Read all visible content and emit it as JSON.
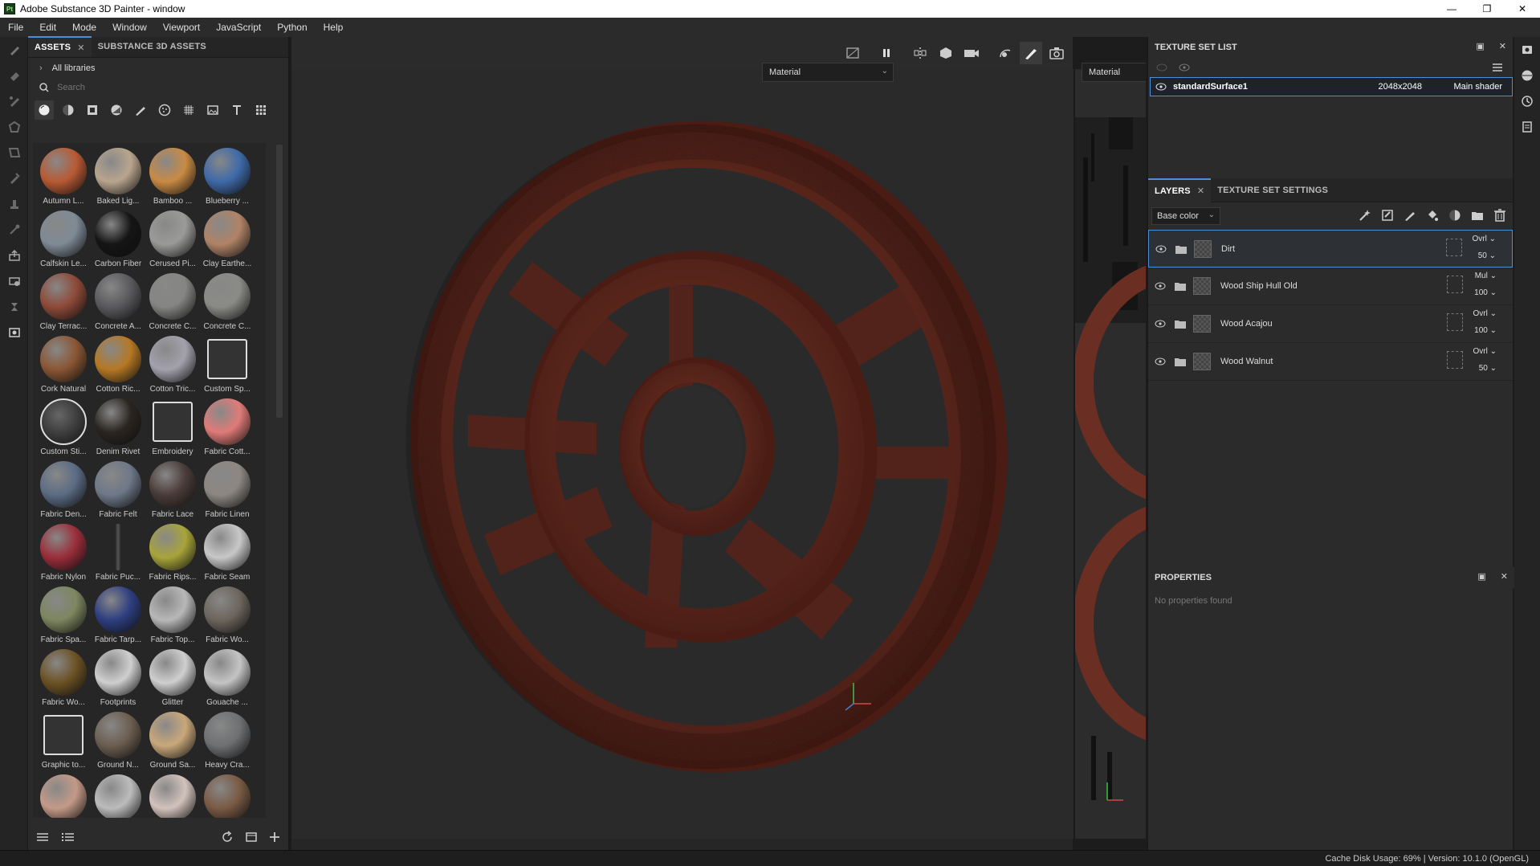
{
  "window": {
    "app_icon": "Pt",
    "title": "Adobe Substance 3D Painter - window",
    "minimize": "—",
    "maximize": "❐",
    "close": "✕"
  },
  "menu": [
    "File",
    "Edit",
    "Mode",
    "Window",
    "Viewport",
    "JavaScript",
    "Python",
    "Help"
  ],
  "assets_panel": {
    "tab_assets": "ASSETS",
    "tab_substance": "SUBSTANCE 3D ASSETS",
    "library": "All libraries",
    "search_placeholder": "Search",
    "items": [
      {
        "label": "Autumn L...",
        "color": "#b85a34",
        "type": "leaf"
      },
      {
        "label": "Baked Lig...",
        "color": "#b9a58e",
        "type": "ball"
      },
      {
        "label": "Bamboo ...",
        "color": "#c98a44",
        "type": "ball"
      },
      {
        "label": "Blueberry ...",
        "color": "#3e6aa8",
        "type": "ball"
      },
      {
        "label": "Calfskin Le...",
        "color": "#7e8a95",
        "type": "ball"
      },
      {
        "label": "Carbon Fiber",
        "color": "#151515",
        "type": "ball"
      },
      {
        "label": "Cerused Pi...",
        "color": "#9a9a98",
        "type": "ball"
      },
      {
        "label": "Clay Earthe...",
        "color": "#b08366",
        "type": "ball"
      },
      {
        "label": "Clay Terrac...",
        "color": "#8e4a38",
        "type": "ball"
      },
      {
        "label": "Concrete A...",
        "color": "#5a5a5e",
        "type": "ball"
      },
      {
        "label": "Concrete C...",
        "color": "#858583",
        "type": "ball"
      },
      {
        "label": "Concrete C...",
        "color": "#8a8a86",
        "type": "ball"
      },
      {
        "label": "Cork Natural",
        "color": "#8a5634",
        "type": "ball"
      },
      {
        "label": "Cotton Ric...",
        "color": "#b57824",
        "type": "ball"
      },
      {
        "label": "Cotton Tric...",
        "color": "#a3a1ac",
        "type": "ball"
      },
      {
        "label": "Custom Sp...",
        "color": "#333333",
        "type": "icon"
      },
      {
        "label": "Custom Sti...",
        "color": "#444444",
        "type": "sticker"
      },
      {
        "label": "Denim Rivet",
        "color": "#2a2520",
        "type": "ball"
      },
      {
        "label": "Embroidery",
        "color": "#333333",
        "type": "icon"
      },
      {
        "label": "Fabric Cott...",
        "color": "#e07b78",
        "type": "ball"
      },
      {
        "label": "Fabric Den...",
        "color": "#5c6c84",
        "type": "ball"
      },
      {
        "label": "Fabric Felt",
        "color": "#6e7888",
        "type": "ball"
      },
      {
        "label": "Fabric Lace",
        "color": "#4a3c38",
        "type": "ball"
      },
      {
        "label": "Fabric Linen",
        "color": "#8d8782",
        "type": "ball"
      },
      {
        "label": "Fabric Nylon",
        "color": "#9a2e3a",
        "type": "ball"
      },
      {
        "label": "Fabric Puc...",
        "color": "#3a3a3a",
        "type": "thin"
      },
      {
        "label": "Fabric Rips...",
        "color": "#a8a43a",
        "type": "ball"
      },
      {
        "label": "Fabric Seam",
        "color": "#c8c8c8",
        "type": "ball"
      },
      {
        "label": "Fabric Spa...",
        "color": "#7d8660",
        "type": "ball"
      },
      {
        "label": "Fabric Tarp...",
        "color": "#2e3e80",
        "type": "ball"
      },
      {
        "label": "Fabric Top...",
        "color": "#b8b8b8",
        "type": "ball"
      },
      {
        "label": "Fabric Wo...",
        "color": "#6d655d",
        "type": "ball"
      },
      {
        "label": "Fabric Wo...",
        "color": "#6c5224",
        "type": "ball"
      },
      {
        "label": "Footprints",
        "color": "#cfcfcf",
        "type": "ball"
      },
      {
        "label": "Glitter",
        "color": "#cfcfcf",
        "type": "ball"
      },
      {
        "label": "Gouache ...",
        "color": "#c4c4c4",
        "type": "ball"
      },
      {
        "label": "Graphic to...",
        "color": "#333333",
        "type": "icon"
      },
      {
        "label": "Ground N...",
        "color": "#6c5e50",
        "type": "ball"
      },
      {
        "label": "Ground Sa...",
        "color": "#c9a87a",
        "type": "ball"
      },
      {
        "label": "Heavy Cra...",
        "color": "#6e7072",
        "type": "ball"
      },
      {
        "label": "",
        "color": "#c49a88",
        "type": "ball"
      },
      {
        "label": "",
        "color": "#bcbcbc",
        "type": "ball"
      },
      {
        "label": "",
        "color": "#d2c2bc",
        "type": "ball"
      },
      {
        "label": "",
        "color": "#7a5a44",
        "type": "ball"
      }
    ]
  },
  "viewport": {
    "material_dropdown_3d": "Material",
    "material_dropdown_2d": "Material"
  },
  "texture_set_list": {
    "title": "TEXTURE SET LIST",
    "row": {
      "name": "standardSurface1",
      "resolution": "2048x2048",
      "shader": "Main shader"
    }
  },
  "layers": {
    "tab_layers": "LAYERS",
    "tab_settings": "TEXTURE SET SETTINGS",
    "channel": "Base color",
    "items": [
      {
        "name": "Dirt",
        "blend": "Ovrl",
        "opacity": "50"
      },
      {
        "name": "Wood Ship Hull Old",
        "blend": "Mul",
        "opacity": "100"
      },
      {
        "name": "Wood Acajou",
        "blend": "Ovrl",
        "opacity": "100"
      },
      {
        "name": "Wood Walnut",
        "blend": "Ovrl",
        "opacity": "50"
      }
    ]
  },
  "properties": {
    "title": "PROPERTIES",
    "empty": "No properties found"
  },
  "status": {
    "text": "Cache Disk Usage:   69% | Version: 10.1.0 (OpenGL)"
  },
  "colors": {
    "accent": "#4a8fd8",
    "wood": "#6b2e22"
  }
}
